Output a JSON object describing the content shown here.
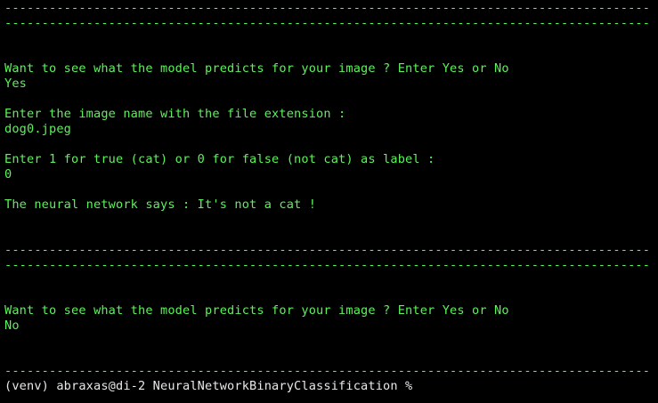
{
  "terminal": {
    "lines": [
      {
        "text": "--------------------------------------------------------------------------------------------------------",
        "kind": "rule"
      },
      {
        "text": "--------------------------------------------------------------------------------------------------------",
        "kind": "rule"
      },
      {
        "text": "Want to see what the model predicts for your image ? Enter Yes or No",
        "kind": "output"
      },
      {
        "text": "Yes",
        "kind": "input"
      },
      {
        "text": "Enter the image name with the file extension :",
        "kind": "output"
      },
      {
        "text": "dog0.jpeg",
        "kind": "input"
      },
      {
        "text": "Enter 1 for true (cat) or 0 for false (not cat) as label :",
        "kind": "output"
      },
      {
        "text": "0",
        "kind": "input"
      },
      {
        "text": "The neural network says : It's not a cat !",
        "kind": "output"
      },
      {
        "text": "--------------------------------------------------------------------------------------------------------",
        "kind": "rule"
      },
      {
        "text": "--------------------------------------------------------------------------------------------------------",
        "kind": "rule"
      },
      {
        "text": "Want to see what the model predicts for your image ? Enter Yes or No",
        "kind": "output"
      },
      {
        "text": "No",
        "kind": "input"
      },
      {
        "text": "--------------------------------------------------------------------------------------------------------",
        "kind": "rule"
      },
      {
        "text": "(venv) abraxas@di-2 NeuralNetworkBinaryClassification %",
        "kind": "prompt"
      }
    ]
  },
  "colors": {
    "background": "#000000",
    "output_text": "#5cf25a",
    "prompt_text": "#e9e9e9"
  }
}
